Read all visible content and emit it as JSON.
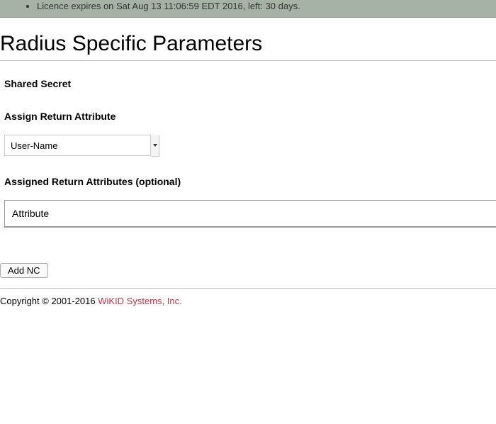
{
  "status": {
    "license_text": "Licence expires on Sat Aug 13 11:06:59 EDT 2016, left: 30 days."
  },
  "page": {
    "title": "Radius Specific Parameters"
  },
  "form": {
    "shared_secret_label": "Shared Secret",
    "assign_return_attr_label": "Assign Return Attribute",
    "return_attr_selected": "User-Name",
    "assigned_return_attrs_label": "Assigned Return Attributes (optional)",
    "attr_table_header": "Attribute",
    "add_nc_label": "Add NC"
  },
  "footer": {
    "copyright": "Copyright © 2001-2016 ",
    "link_text": "WiKID Systems, Inc."
  }
}
